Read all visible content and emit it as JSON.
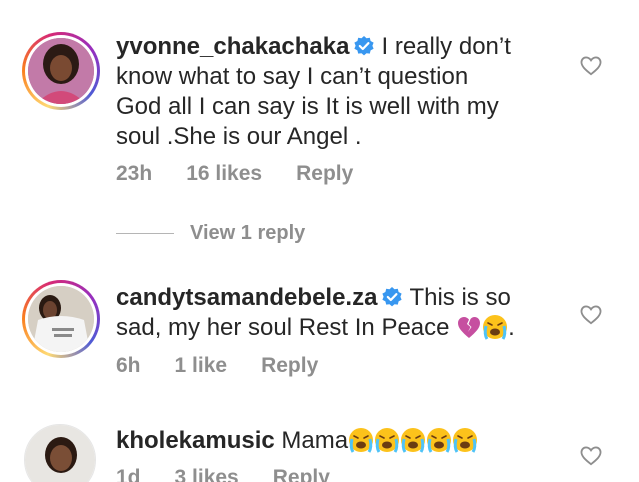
{
  "comments": [
    {
      "username": "yvonne_chakachaka",
      "text_lines": [
        "I really don’t",
        "know what to say I can’t question",
        "God all I can say is It is well with my",
        "soul .She is our Angel ."
      ],
      "time": "23h",
      "likes": "16 likes",
      "reply": "Reply",
      "avatar": "woman-portrait-avatar"
    },
    {
      "username": "candytsamandebele.za",
      "text_lines": [
        "This is so",
        "sad, my her soul Rest In Peace",
        "."
      ],
      "time": "6h",
      "likes": "1 like",
      "reply": "Reply",
      "avatar": "woman-tshirt-avatar"
    },
    {
      "username": "kholekamusic",
      "text_lines": [
        "Mama"
      ],
      "time": "1d",
      "likes": "3 likes",
      "reply": "Reply",
      "avatar": "woman-portrait-avatar"
    }
  ],
  "view_replies": "View 1 reply",
  "icons": {
    "verified": "verified-badge-icon",
    "like": "heart-outline-icon",
    "broken_heart": "broken-heart-emoji",
    "crying": "loudly-crying-face-emoji"
  },
  "colors": {
    "verified_blue": "#3897f0",
    "muted": "#8e8e8e",
    "text": "#262626"
  }
}
